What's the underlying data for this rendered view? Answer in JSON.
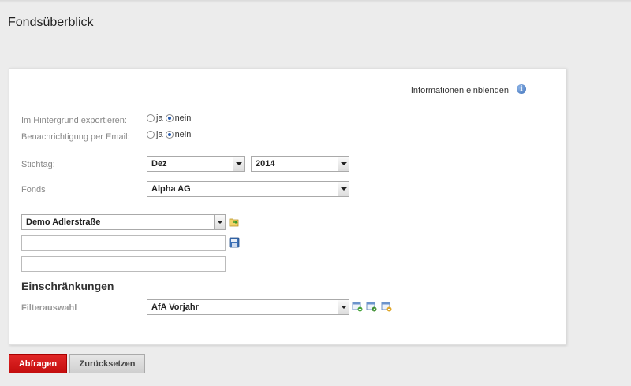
{
  "page": {
    "title": "Fondsüberblick"
  },
  "panel": {
    "info_link": "Informationen einblenden",
    "export_background": {
      "label": "Im Hintergrund exportieren:",
      "option_yes": "ja",
      "option_no": "nein",
      "selected": "nein"
    },
    "email_notification": {
      "label": "Benachrichtigung per Email:",
      "option_yes": "ja",
      "option_no": "nein",
      "selected": "nein"
    },
    "stichtag": {
      "label": "Stichtag:",
      "month": "Dez",
      "year": "2014"
    },
    "fonds": {
      "label": "Fonds",
      "value": "Alpha AG"
    },
    "property_select": {
      "value": "Demo Adlerstraße"
    },
    "name_input": {
      "value": ""
    },
    "extra_input": {
      "value": ""
    },
    "restrictions": {
      "title": "Einschränkungen",
      "filter_label": "Filterauswahl",
      "filter_value": "AfA Vorjahr"
    }
  },
  "buttons": {
    "query": "Abfragen",
    "reset": "Zurücksetzen"
  },
  "colors": {
    "primary": "#d01a1a",
    "background": "#ececec",
    "panel": "#ffffff"
  }
}
